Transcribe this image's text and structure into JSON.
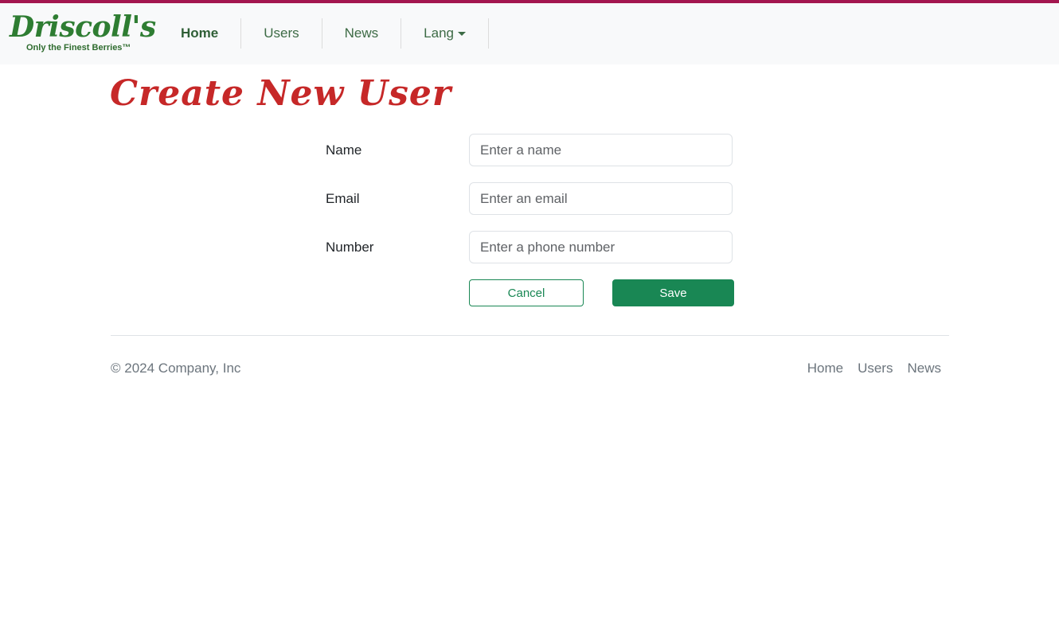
{
  "brand": {
    "name": "Driscoll's",
    "tagline": "Only the Finest Berries™"
  },
  "nav": {
    "items": [
      {
        "label": "Home"
      },
      {
        "label": "Users"
      },
      {
        "label": "News"
      },
      {
        "label": "Lang"
      }
    ]
  },
  "page": {
    "title": "Create New User"
  },
  "form": {
    "name": {
      "label": "Name",
      "placeholder": "Enter a name",
      "value": ""
    },
    "email": {
      "label": "Email",
      "placeholder": "Enter an email",
      "value": ""
    },
    "number": {
      "label": "Number",
      "placeholder": "Enter a phone number",
      "value": ""
    },
    "cancel_label": "Cancel",
    "save_label": "Save"
  },
  "footer": {
    "copyright": "© 2024 Company, Inc",
    "links": [
      {
        "label": "Home"
      },
      {
        "label": "Users"
      },
      {
        "label": "News"
      }
    ]
  },
  "colors": {
    "accent_bar": "#a3164f",
    "brand_green": "#2e7d32",
    "title_red": "#c62828",
    "button_green": "#198754"
  }
}
